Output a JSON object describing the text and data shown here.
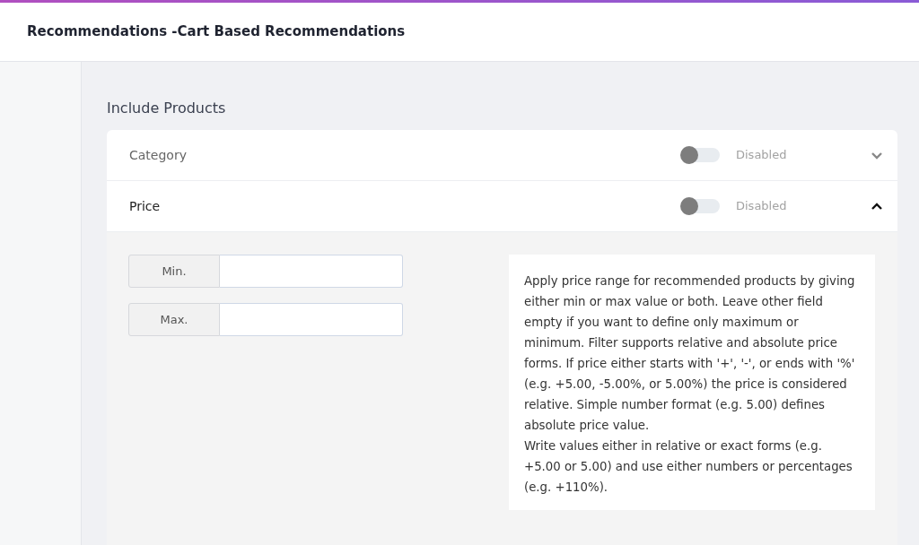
{
  "header": {
    "title": "Recommendations -Cart Based Recommendations"
  },
  "section": {
    "title": "Include Products"
  },
  "filters": [
    {
      "label": "Category",
      "enabled": false,
      "status": "Disabled",
      "expanded": false
    },
    {
      "label": "Price",
      "enabled": false,
      "status": "Disabled",
      "expanded": true
    }
  ],
  "price_body": {
    "fields": [
      {
        "label": "Min."
      },
      {
        "label": "Max."
      }
    ],
    "help_paragraphs": [
      "Apply price range for recommended products by giving either min or max value or both. Leave other field empty if you want to define only maximum or minimum. Filter supports relative and absolute price forms. If price either starts with '+', '-', or ends with '%' (e.g. +5.00, -5.00%, or 5.00%) the price is considered relative. Simple number format (e.g. 5.00) defines absolute price value.",
      "Write values either in relative or exact forms (e.g. +5.00 or 5.00) and use either numbers or percentages (e.g. +110%)."
    ]
  }
}
